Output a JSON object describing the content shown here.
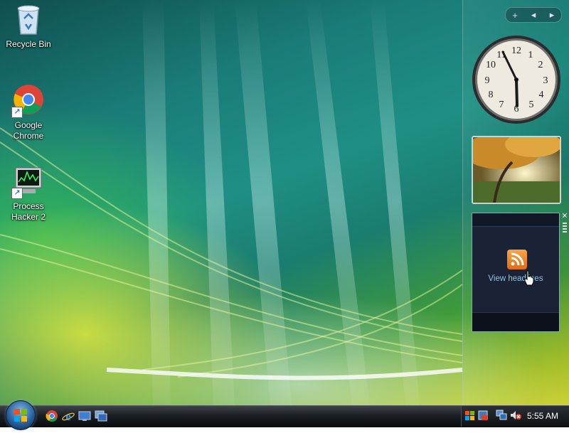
{
  "desktop": {
    "icons": [
      {
        "label": "Recycle Bin",
        "icon": "recycle-bin-icon"
      },
      {
        "label": "Google Chrome",
        "icon": "chrome-icon"
      },
      {
        "label": "Process Hacker 2",
        "icon": "process-hacker-icon"
      }
    ]
  },
  "sidebar": {
    "controls": {
      "add": "+",
      "prev": "◂",
      "next": "▸"
    },
    "clock": {
      "time": "5:55"
    },
    "feed": {
      "label": "View headlines"
    }
  },
  "taskbar": {
    "quick_launch": [
      "chrome-icon",
      "internet-explorer-icon",
      "show-desktop-icon",
      "switch-windows-icon"
    ],
    "tray": {
      "time": "5:55 AM",
      "icons": [
        "windows-security-icon",
        "network-icon",
        "volume-muted-icon"
      ]
    }
  }
}
